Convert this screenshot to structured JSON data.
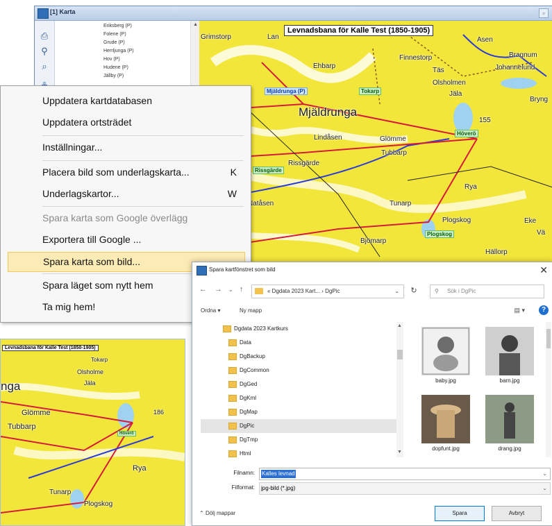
{
  "map_window": {
    "title": "[1] Karta",
    "tree_items": [
      "Eriksberg (P)",
      "Folene (P)",
      "Grude (P)",
      "Herrljunga (P)",
      "Hov (P)",
      "Hudene (P)",
      "Jällby (P)"
    ],
    "map_title": "Levnadsbana för Kalle Test (1850-1905)",
    "places": [
      "Grimstorp",
      "Lan",
      "Ehbarp",
      "Finnestorp",
      "Täs",
      "Asen",
      "Bragnum",
      "Johannelund",
      "Olsholmen",
      "Jäla",
      "Bryng",
      "Mjäldrunga",
      "Lindåsen",
      "Glömme",
      "Tubbarp",
      "Rissgärde",
      "Natåsen",
      "Tunarp",
      "Bjömarp",
      "Plogskog",
      "Hällorp",
      "Rya",
      "Eke",
      "Vä",
      "155"
    ],
    "labels": {
      "mjaldrunga": "Mjäldrunga (P)",
      "tokarp": "Tokarp",
      "hovero": "Höverö",
      "rissgarde": "Rissgärde",
      "plogskog": "Plogskog"
    }
  },
  "context_menu": {
    "items": [
      {
        "label": "Uppdatera kartdatabasen",
        "shortcut": "",
        "disabled": false,
        "hover": false
      },
      {
        "label": "Uppdatera ortsträdet",
        "shortcut": "",
        "disabled": false,
        "hover": false
      },
      {
        "label": "Inställningar...",
        "shortcut": "",
        "disabled": false,
        "hover": false
      },
      {
        "label": "Placera bild som underlagskarta...",
        "shortcut": "K",
        "disabled": false,
        "hover": false
      },
      {
        "label": "Underlagskartor...",
        "shortcut": "W",
        "disabled": false,
        "hover": false
      },
      {
        "label": "Spara karta som Google överlägg",
        "shortcut": "",
        "disabled": true,
        "hover": false
      },
      {
        "label": "Exportera till Google ...",
        "shortcut": "",
        "disabled": false,
        "hover": false
      },
      {
        "label": "Spara karta som bild...",
        "shortcut": "",
        "disabled": false,
        "hover": true
      },
      {
        "label": "Spara läget som nytt hem",
        "shortcut": "",
        "disabled": false,
        "hover": false
      },
      {
        "label": "Ta mig hem!",
        "shortcut": "",
        "disabled": false,
        "hover": false
      }
    ]
  },
  "background_map": {
    "title": "Levnadsbana för Kalle Test (1850-1905)",
    "places": [
      "Tokarp",
      "Olsholme",
      "Jäla",
      "nga",
      "Glömme",
      "Tubbarp",
      "186",
      "Rya",
      "Tunarp",
      "Plogskog",
      "Höverö"
    ]
  },
  "save_dialog": {
    "title": "Spara kartfönstret som bild",
    "breadcrumb": "« Dgdata 2023 Kart... › DgPic",
    "search_placeholder": "Sök i DgPic",
    "organize_label": "Ordna ▾",
    "new_folder_label": "Ny mapp",
    "folders": [
      "Dgdata 2023 Kartkurs",
      "Data",
      "DgBackup",
      "DgCommon",
      "DgGed",
      "DgKml",
      "DgMap",
      "DgPic",
      "DgTmp",
      "Html"
    ],
    "selected_folder": "DgPic",
    "files": [
      "baby.jpg",
      "barn.jpg",
      "dopfunt.jpg",
      "drang.jpg"
    ],
    "filename_label": "Filnamn:",
    "filename_value": "Kalles levnad",
    "filetype_label": "Filformat:",
    "filetype_value": "jpg-bild (*.jpg)",
    "hide_folders": "Dölj mappar",
    "save_button": "Spara",
    "cancel_button": "Avbryt"
  }
}
